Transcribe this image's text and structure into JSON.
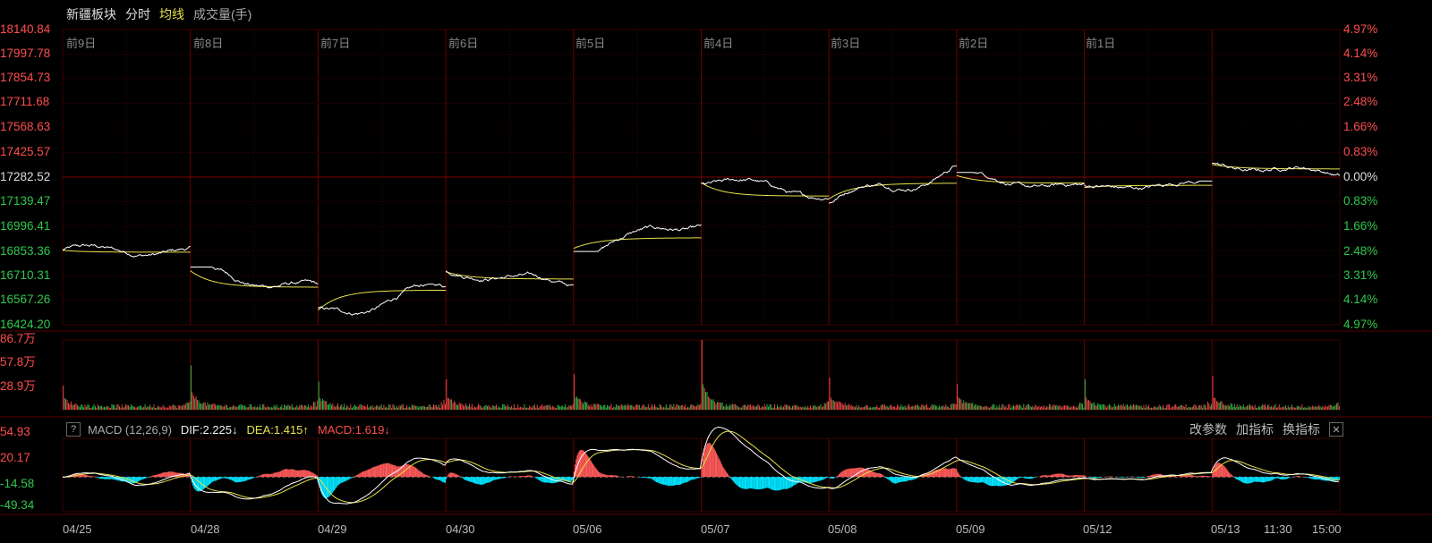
{
  "header": {
    "sector_name": "新疆板块",
    "tab_intraday": "分时",
    "tab_avg_line": "均线",
    "volume_label": "成交量(手)"
  },
  "price_axis": {
    "left": [
      "18140.84",
      "17997.78",
      "17854.73",
      "17711.68",
      "17568.63",
      "17425.57",
      "17282.52",
      "17139.47",
      "16996.41",
      "16853.36",
      "16710.31",
      "16567.26",
      "16424.20"
    ],
    "right": [
      "4.97%",
      "4.14%",
      "3.31%",
      "2.48%",
      "1.66%",
      "0.83%",
      "0.00%",
      "0.83%",
      "1.66%",
      "2.48%",
      "3.31%",
      "4.14%",
      "4.97%"
    ],
    "prev_close": 17282.52
  },
  "day_labels": [
    "前9日",
    "前8日",
    "前7日",
    "前6日",
    "前5日",
    "前4日",
    "前3日",
    "前2日",
    "前1日"
  ],
  "volume_axis": [
    "86.7万",
    "57.8万",
    "28.9万"
  ],
  "macd": {
    "help": "?",
    "name": "MACD (12,26,9)",
    "dif": "DIF:2.225↓",
    "dea": "DEA:1.415↑",
    "macd": "MACD:1.619↓",
    "modify_params": "改参数",
    "add_indicator": "加指标",
    "switch_indicator": "换指标",
    "close": "✕",
    "axis": [
      "54.93",
      "20.17",
      "-14.58",
      "-49.34"
    ]
  },
  "date_labels": [
    "04/25",
    "04/28",
    "04/29",
    "04/30",
    "05/06",
    "05/07",
    "05/08",
    "05/09",
    "05/12",
    "05/13",
    "11:30",
    "15:00"
  ],
  "colors": {
    "up": "#ff4d4d",
    "down": "#2fc84b",
    "price_line": "#ffffff",
    "avg_line": "#e8e04a",
    "grid": "#3a0000",
    "macd_pos": "#ff5a5a",
    "macd_neg": "#00e5ff"
  },
  "chart_data": {
    "type": "line",
    "title": "",
    "days": [
      "04/25",
      "04/28",
      "04/29",
      "04/30",
      "05/06",
      "05/07",
      "05/08",
      "05/09",
      "05/12",
      "05/13"
    ],
    "price_open": [
      16860,
      16760,
      16480,
      16740,
      16860,
      17270,
      17140,
      17300,
      17220,
      17360
    ],
    "price_close": [
      16850,
      16620,
      16640,
      16660,
      17020,
      17180,
      17330,
      17210,
      17250,
      17300
    ],
    "price_high": [
      16920,
      16760,
      16660,
      16750,
      17020,
      17280,
      17350,
      17310,
      17260,
      17420
    ],
    "price_low": [
      16800,
      16560,
      16440,
      16640,
      16850,
      17120,
      17110,
      17170,
      17180,
      17290
    ],
    "avg_price": [
      16845,
      16650,
      16620,
      16700,
      16900,
      17170,
      17220,
      17260,
      17230,
      17340
    ],
    "volume_peak_wan": [
      30,
      55,
      35,
      38,
      44,
      86.7,
      40,
      32,
      38,
      42
    ],
    "ylim": [
      16424.2,
      18140.84
    ],
    "volume_ylim_wan": [
      0,
      86.7
    ],
    "macd_ylim": [
      -49.34,
      54.93
    ]
  }
}
